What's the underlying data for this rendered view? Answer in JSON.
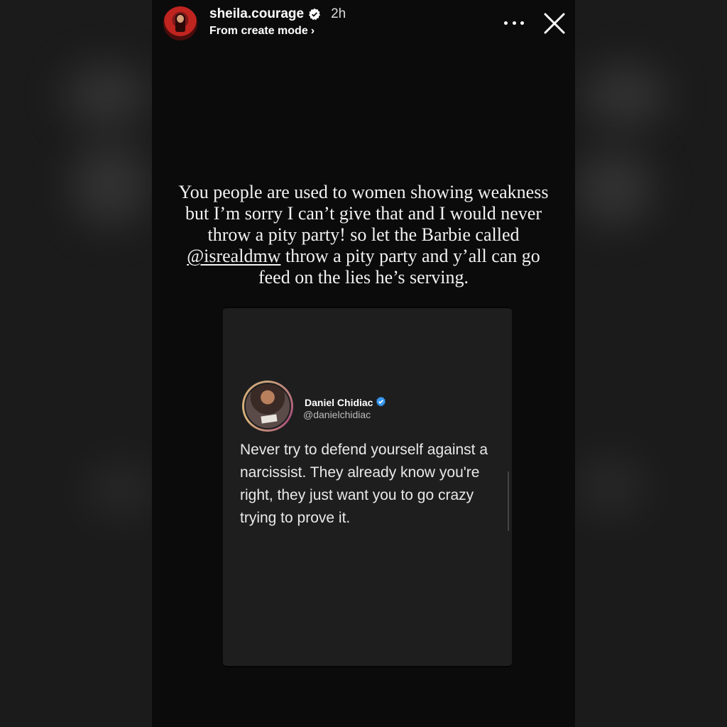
{
  "header": {
    "username": "sheila.courage",
    "time": "2h",
    "subtitle": "From create mode",
    "subtitle_chevron": "›",
    "icons": {
      "avatar": "profile-avatar",
      "verified": "verified-badge-icon",
      "more": "more-options-icon",
      "close": "close-icon"
    }
  },
  "caption": {
    "before_mention": "You people are used to women showing weakness but I’m sorry I can’t give that and I would never throw a pity party! so let the Barbie called ",
    "mention": "@isrealdmw",
    "after_mention": " throw a pity party and y’all can go feed on the lies he’s serving."
  },
  "tweet": {
    "author_name": "Daniel Chidiac",
    "author_handle": "@danielchidiac",
    "text": "Never try to defend yourself against a narcissist. They already know you're right, they just want you to go crazy trying to prove it."
  },
  "colors": {
    "verified_blue": "#3897f0",
    "story_bg": "#0b0b0b",
    "card_bg": "#1e1e1e"
  }
}
